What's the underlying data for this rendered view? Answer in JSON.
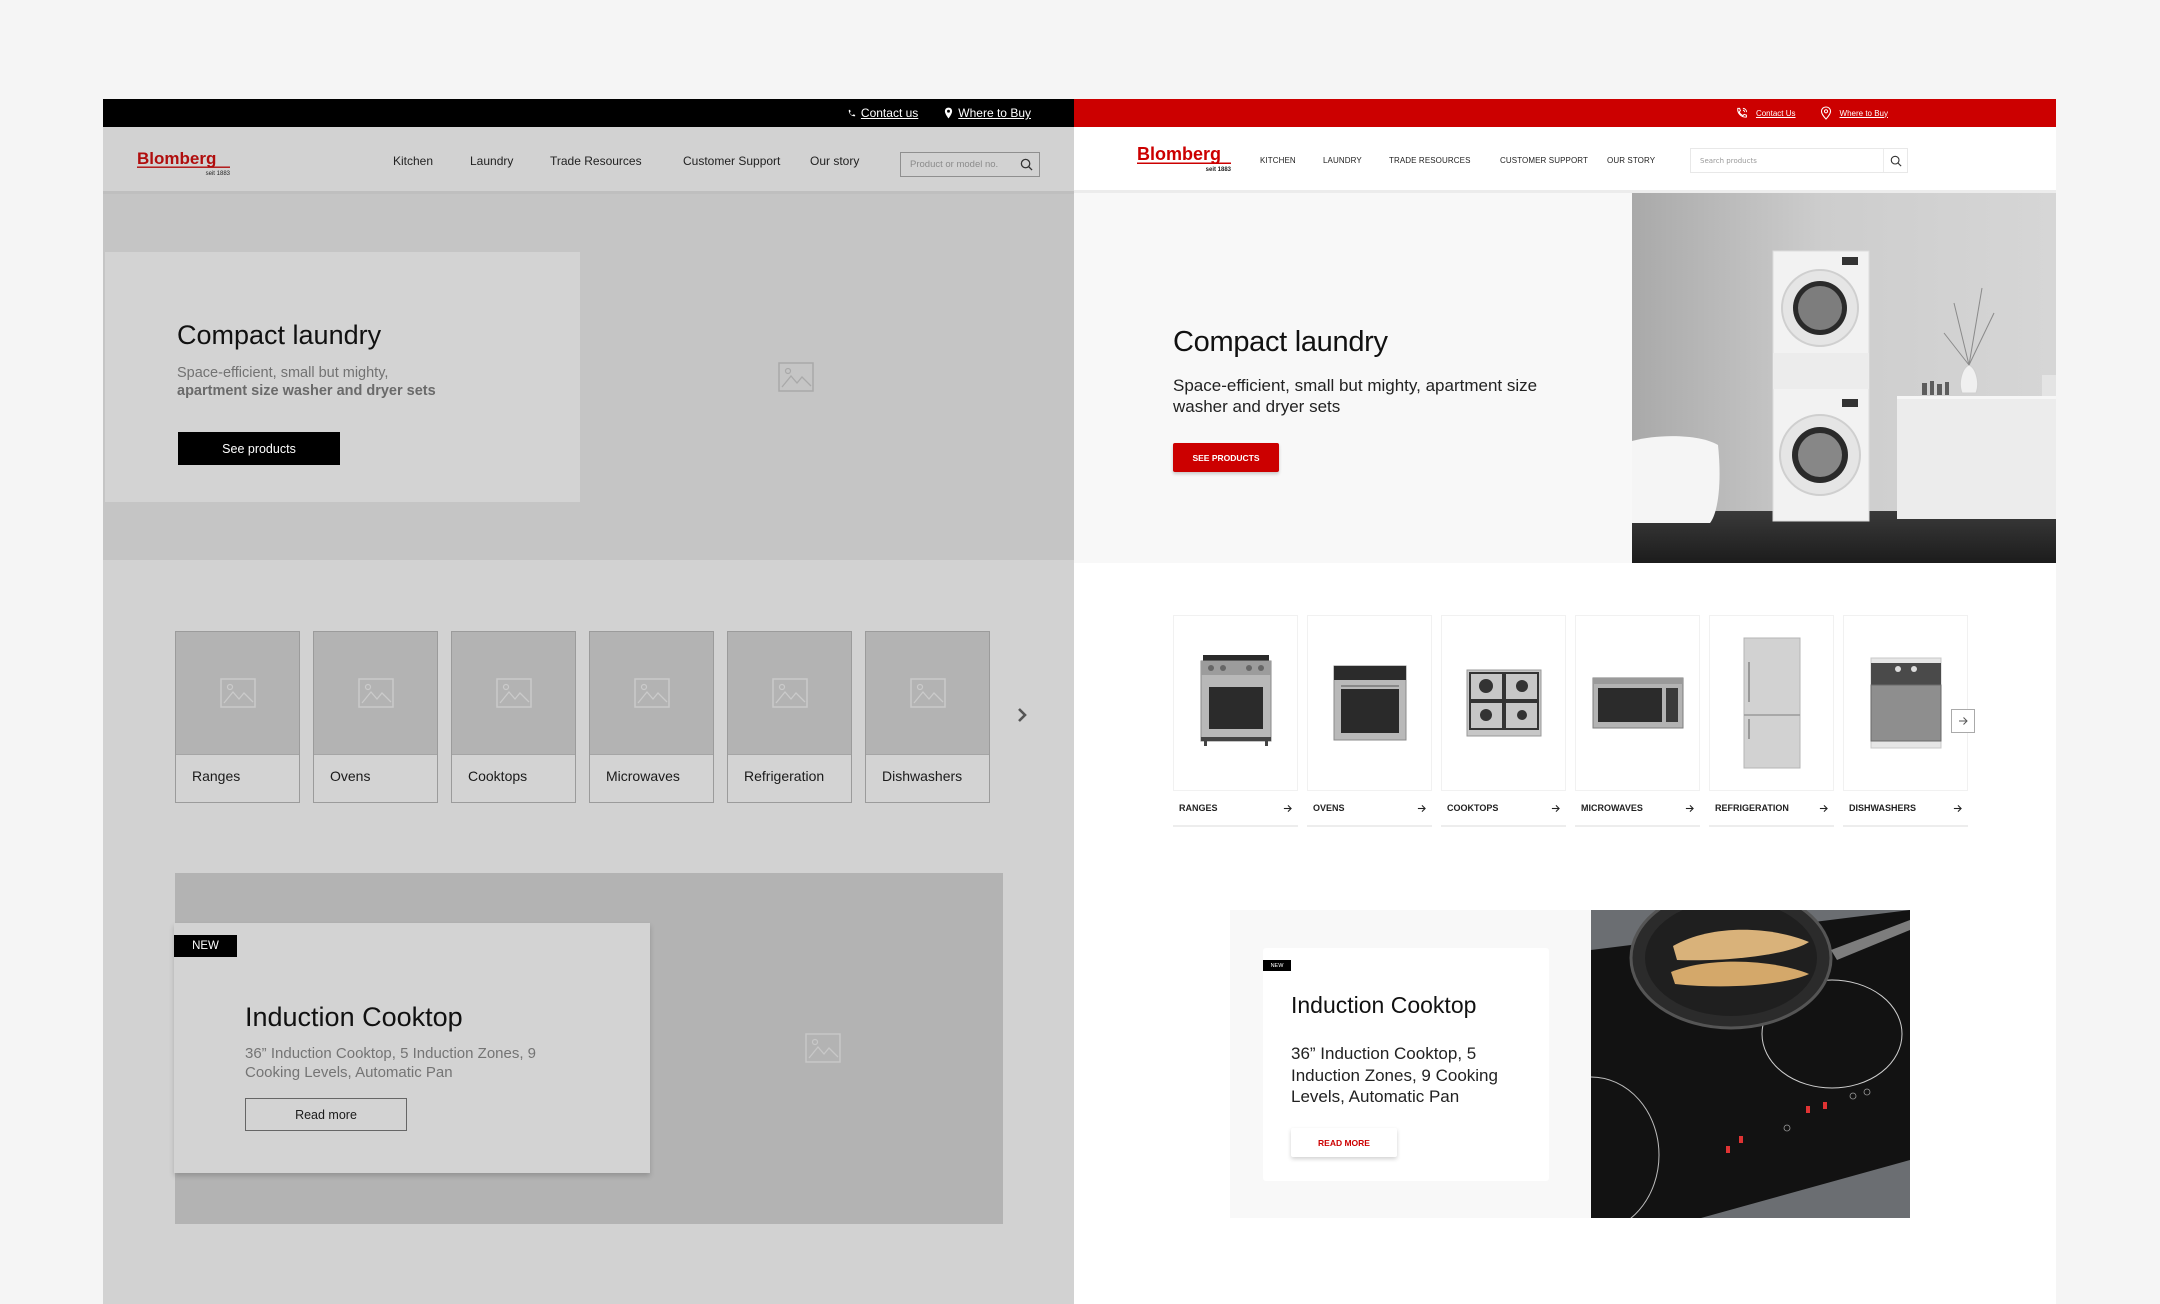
{
  "wireframe": {
    "topbar": {
      "contact_label": "Contact us",
      "where_to_buy_label": "Where to Buy"
    },
    "header": {
      "logo_text": "Blomberg",
      "logo_tagline": "seit 1883",
      "nav": [
        "Kitchen",
        "Laundry",
        "Trade Resources",
        "Customer Support",
        "Our story"
      ],
      "search_placeholder": "Product or model no."
    },
    "hero": {
      "title": "Compact laundry",
      "subtitle_line1": "Space-efficient, small but mighty,",
      "subtitle_line2": "apartment size washer and dryer sets",
      "button_label": "See products"
    },
    "categories": [
      "Ranges",
      "Ovens",
      "Cooktops",
      "Microwaves",
      "Refrigeration",
      "Dishwashers"
    ],
    "promo": {
      "badge": "NEW",
      "title": "Induction Cooktop",
      "description": "36” Induction Cooktop, 5 Induction Zones, 9 Cooking Levels, Automatic Pan",
      "button_label": "Read more"
    }
  },
  "design": {
    "topbar": {
      "contact_label": "Contact Us",
      "where_to_buy_label": "Where to Buy"
    },
    "header": {
      "logo_text": "Blomberg",
      "logo_tagline": "seit 1883",
      "nav": [
        "KITCHEN",
        "LAUNDRY",
        "TRADE RESOURCES",
        "CUSTOMER SUPPORT",
        "OUR STORY"
      ],
      "search_placeholder": "Search products"
    },
    "hero": {
      "title": "Compact laundry",
      "subtitle": "Space-efficient, small but mighty, apartment size washer and dryer sets",
      "button_label": "SEE PRODUCTS"
    },
    "categories": [
      "RANGES",
      "OVENS",
      "COOKTOPS",
      "MICROWAVES",
      "REFRIGERATION",
      "DISHWASHERS"
    ],
    "promo": {
      "badge": "NEW",
      "title": "Induction Cooktop",
      "description": "36” Induction Cooktop, 5 Induction Zones, 9 Cooking Levels, Automatic Pan",
      "button_label": "READ MORE"
    }
  },
  "colors": {
    "brand_red": "#cc0000",
    "wire_black": "#000000",
    "wire_gray": "#d2d2d2",
    "canvas": "#f5f5f5"
  }
}
